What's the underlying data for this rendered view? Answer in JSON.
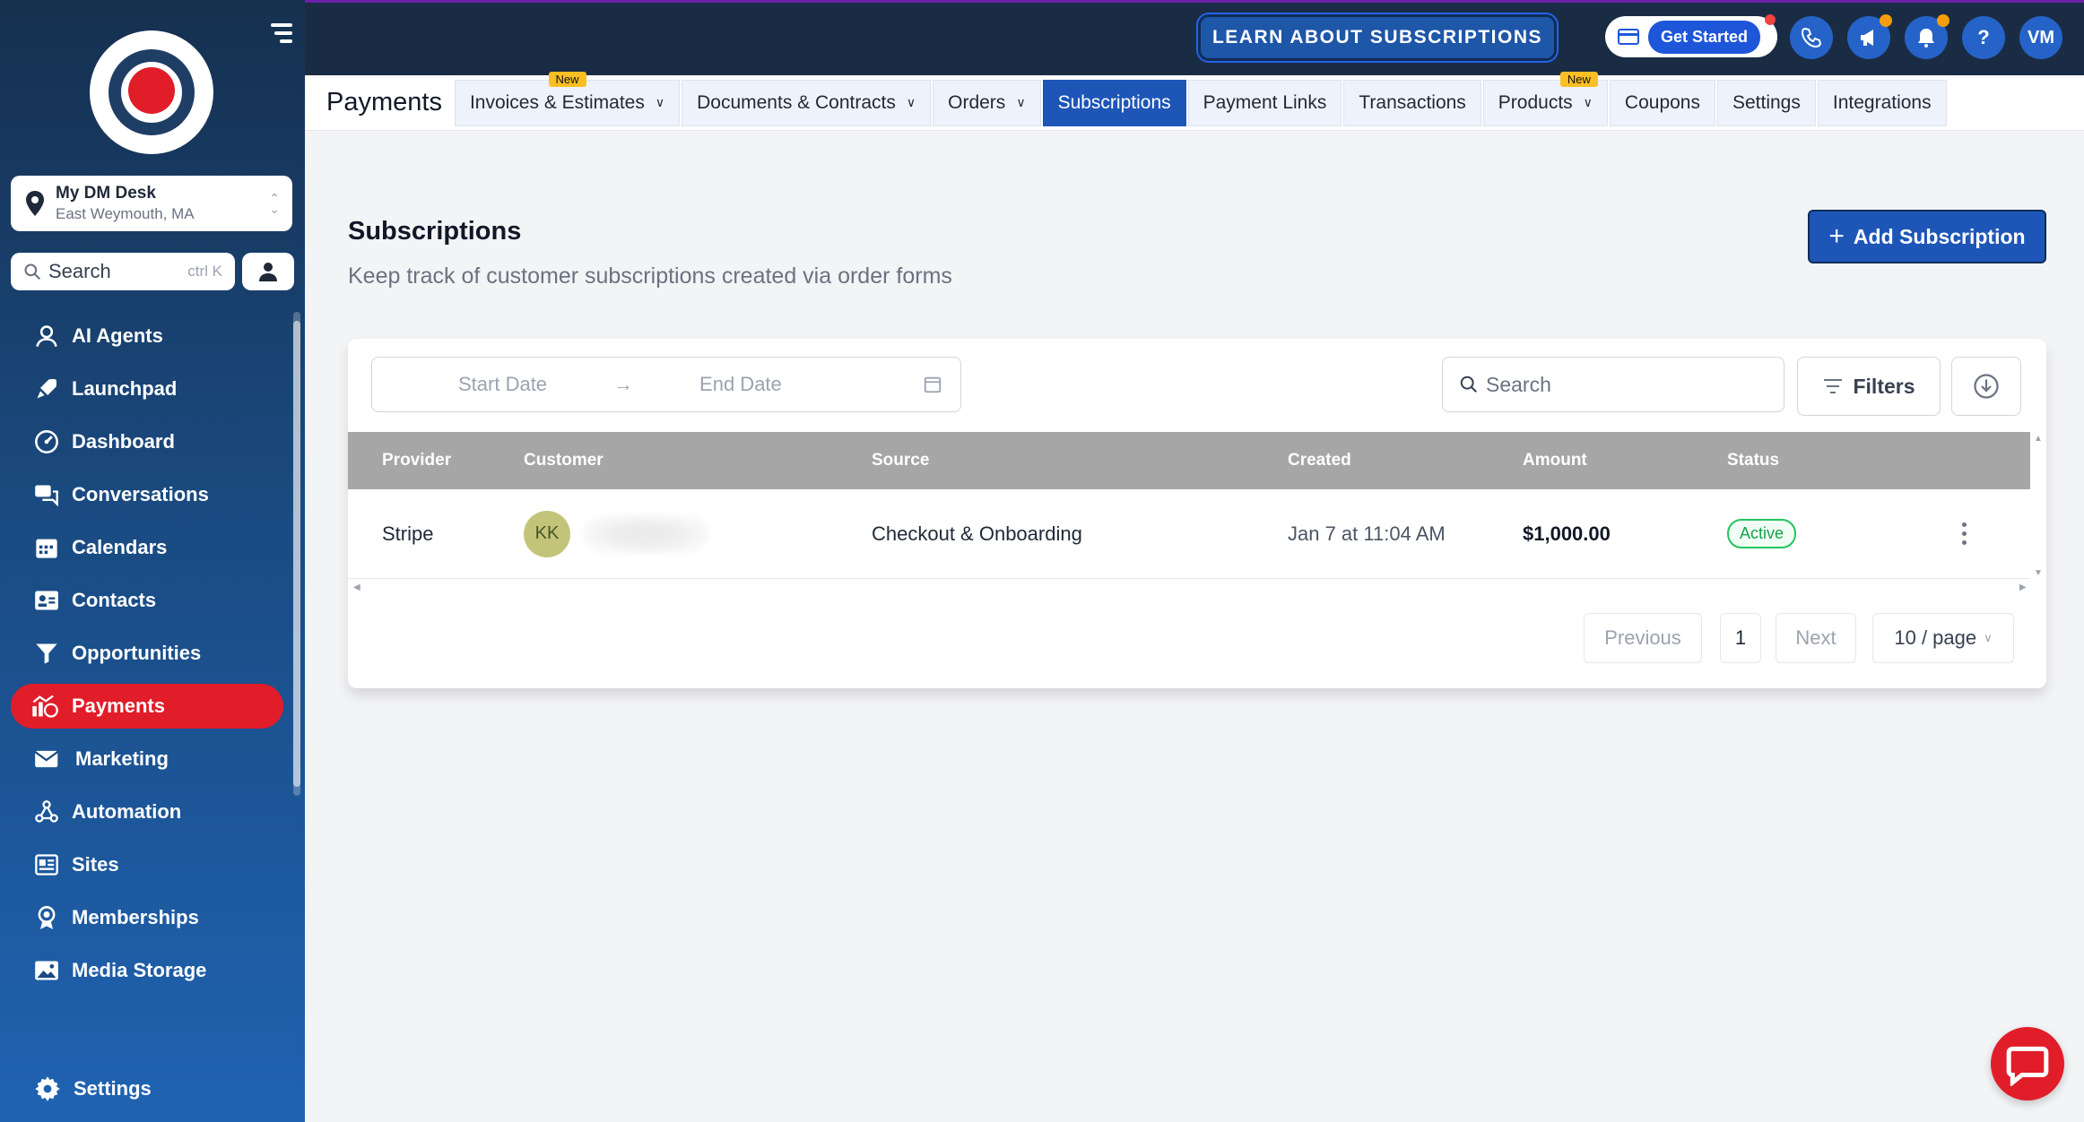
{
  "sidebar": {
    "location": {
      "name": "My DM Desk",
      "address": "East Weymouth, MA"
    },
    "search": {
      "label": "Search",
      "shortcut": "ctrl K"
    },
    "items": [
      {
        "label": "AI Agents",
        "icon": "ai-agent-icon"
      },
      {
        "label": "Launchpad",
        "icon": "rocket-icon"
      },
      {
        "label": "Dashboard",
        "icon": "gauge-icon"
      },
      {
        "label": "Conversations",
        "icon": "chat-icon"
      },
      {
        "label": "Calendars",
        "icon": "calendar-icon"
      },
      {
        "label": "Contacts",
        "icon": "contact-card-icon"
      },
      {
        "label": "Opportunities",
        "icon": "funnel-icon"
      },
      {
        "label": "Payments",
        "icon": "payments-icon",
        "active": true
      },
      {
        "label": "Marketing",
        "icon": "mail-icon"
      },
      {
        "label": "Automation",
        "icon": "automation-icon"
      },
      {
        "label": "Sites",
        "icon": "sites-icon"
      },
      {
        "label": "Memberships",
        "icon": "award-icon"
      },
      {
        "label": "Media Storage",
        "icon": "image-icon"
      }
    ],
    "settings_label": "Settings"
  },
  "topbar": {
    "learn_label": "LEARN ABOUT SUBSCRIPTIONS",
    "get_started_label": "Get Started",
    "user_initials": "VM",
    "help_label": "?"
  },
  "tabs": {
    "page_title": "Payments",
    "items": [
      {
        "label": "Invoices & Estimates",
        "dropdown": true,
        "new": "New"
      },
      {
        "label": "Documents & Contracts",
        "dropdown": true
      },
      {
        "label": "Orders",
        "dropdown": true
      },
      {
        "label": "Subscriptions",
        "active": true
      },
      {
        "label": "Payment Links"
      },
      {
        "label": "Transactions"
      },
      {
        "label": "Products",
        "dropdown": true,
        "new": "New"
      },
      {
        "label": "Coupons"
      },
      {
        "label": "Settings"
      },
      {
        "label": "Integrations"
      }
    ]
  },
  "main": {
    "title": "Subscriptions",
    "subtitle": "Keep track of customer subscriptions created via order forms",
    "add_button": "Add Subscription",
    "add_plus": "+",
    "date_range": {
      "start_placeholder": "Start Date",
      "end_placeholder": "End Date",
      "arrow": "→"
    },
    "search_placeholder": "Search",
    "filters_label": "Filters",
    "table": {
      "columns": [
        "Provider",
        "Customer",
        "Source",
        "Created",
        "Amount",
        "Status"
      ],
      "rows": [
        {
          "provider": "Stripe",
          "customer_initials": "KK",
          "source": "Checkout & Onboarding",
          "created": "Jan 7 at 11:04 AM",
          "amount": "$1,000.00",
          "status": "Active"
        }
      ]
    },
    "pagination": {
      "previous": "Previous",
      "page": "1",
      "next": "Next",
      "page_size": "10 / page"
    }
  },
  "colors": {
    "accent": "#1e56b8",
    "active_nav": "#e11d2a",
    "status_active": "#16a34a"
  }
}
